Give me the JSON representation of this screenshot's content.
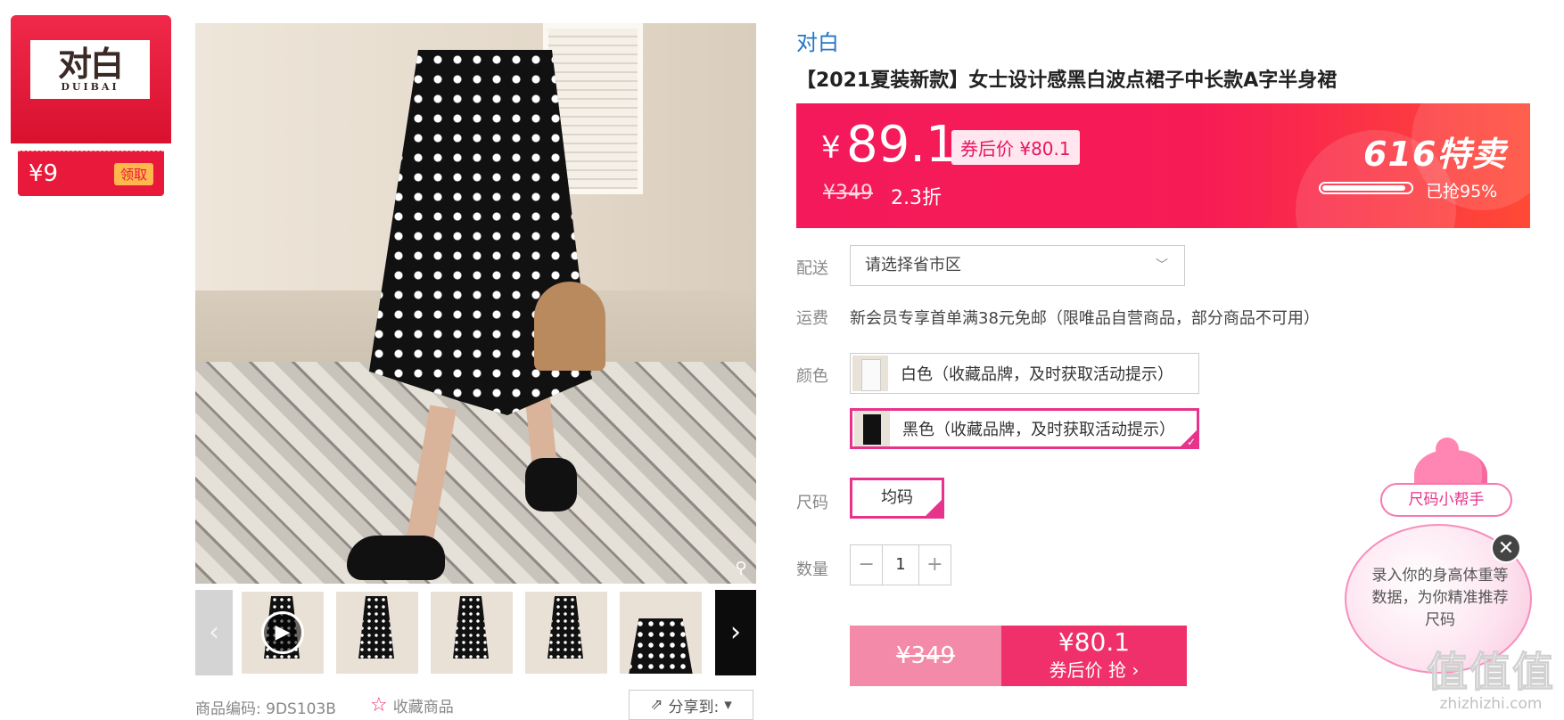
{
  "brand_card": {
    "logo_cn": "对白",
    "logo_en": "DUIBAI",
    "coupon_amount": "¥9",
    "coupon_button": "领取"
  },
  "gallery": {
    "zoom_icon": "magnifier-icon",
    "prev_icon": "chevron-left-icon",
    "next_icon": "chevron-right-icon",
    "thumbnails": [
      "video",
      "image",
      "image",
      "image",
      "image"
    ],
    "sku_label": "商品编码:",
    "sku_value": "9DS103B",
    "favorite_label": "收藏商品",
    "share_label": "分享到:"
  },
  "product": {
    "brand": "对白",
    "title": "【2021夏装新款】女士设计感黑白波点裙子中长款A字半身裙"
  },
  "price_banner": {
    "currency": "¥",
    "price": "89.1",
    "coupon_price": "券后价 ¥80.1",
    "original_price": "¥349",
    "discount": "2.3折",
    "promo_title": "616特卖",
    "sold_percent": 95,
    "sold_text": "已抢95%",
    "colors": {
      "start": "#f4195a",
      "end": "#ff4a35"
    }
  },
  "delivery": {
    "label": "配送",
    "placeholder": "请选择省市区"
  },
  "shipping": {
    "label": "运费",
    "text": "新会员专享首单满38元免邮（限唯品自营商品，部分商品不可用）"
  },
  "color": {
    "label": "颜色",
    "options": [
      {
        "label": "白色（收藏品牌，及时获取活动提示）",
        "selected": false
      },
      {
        "label": "黑色（收藏品牌，及时获取活动提示）",
        "selected": true
      }
    ]
  },
  "size": {
    "label": "尺码",
    "options": [
      {
        "label": "均码",
        "selected": true
      }
    ]
  },
  "quantity": {
    "label": "数量",
    "minus": "−",
    "value": "1",
    "plus": "+"
  },
  "buy": {
    "original_price": "¥349",
    "coupon_price": "¥80.1",
    "action": "券后价 抢 ›"
  },
  "size_helper": {
    "button": "尺码小帮手",
    "bubble_text": "录入你的身高体重等数据，为你精准推荐尺码",
    "close": "✕"
  },
  "watermark": {
    "cn": "值值值",
    "en": "zhizhizhi.com"
  },
  "accent_color": "#e8338c"
}
